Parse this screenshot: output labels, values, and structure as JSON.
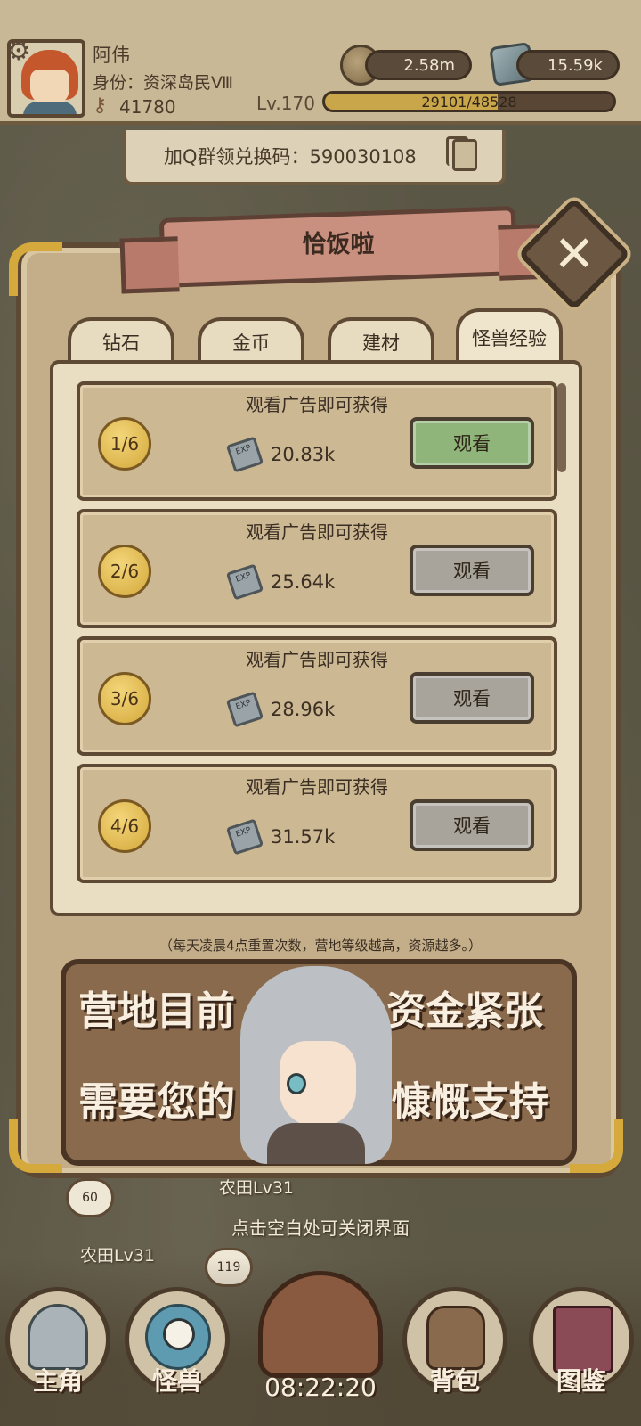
{
  "hud": {
    "player_name": "阿伟",
    "identity": "身份：资深岛民Ⅷ",
    "keys": "41780",
    "level": "Lv.170",
    "xp_text": "29101/48528",
    "xp_fraction": 0.5997,
    "coins": "2.58m",
    "stones": "15.59k"
  },
  "redeem": {
    "text": "加Q群领兑换码：590030108"
  },
  "modal": {
    "title": "恰饭啦",
    "close_symbol": "✕",
    "tabs": [
      "钻石",
      "金币",
      "建材",
      "怪兽经验"
    ],
    "active_tab": "怪兽经验",
    "cards": [
      {
        "title": "观看广告即可获得",
        "count": "1/6",
        "amount": "20.83k",
        "button": "观看",
        "enabled": true
      },
      {
        "title": "观看广告即可获得",
        "count": "2/6",
        "amount": "25.64k",
        "button": "观看",
        "enabled": false
      },
      {
        "title": "观看广告即可获得",
        "count": "3/6",
        "amount": "28.96k",
        "button": "观看",
        "enabled": false
      },
      {
        "title": "观看广告即可获得",
        "count": "4/6",
        "amount": "31.57k",
        "button": "观看",
        "enabled": false
      }
    ],
    "note": "（每天凌晨4点重置次数，营地等级越高，资源越多。）",
    "promo_lines": [
      "营地目前",
      "资金紧张",
      "需要您的",
      "慷慨支持"
    ]
  },
  "scene": {
    "close_hint": "点击空白处可关闭界面",
    "farm_labels": [
      "农田Lv31",
      "农田Lv31"
    ],
    "bubble_counts": [
      "60",
      "119"
    ]
  },
  "nav": {
    "items": [
      "主角",
      "怪兽",
      "背包",
      "图鉴"
    ],
    "timer": "08:22:20"
  },
  "colors": {
    "watch_enabled": "#8fb57a",
    "watch_disabled": "#a8a49c",
    "panel": "#c4ae8a",
    "ribbon": "#c98f7f"
  }
}
